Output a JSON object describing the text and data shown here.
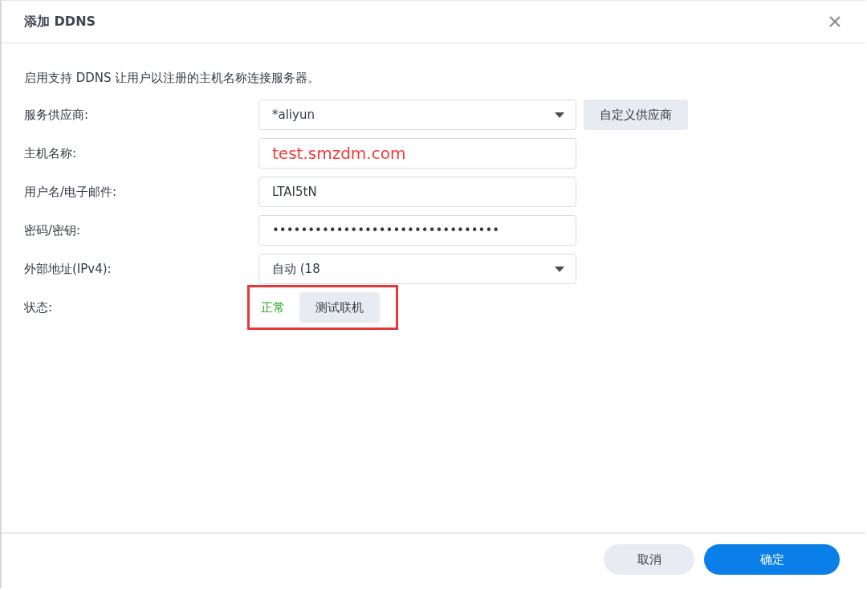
{
  "window": {
    "title": "添加 DDNS"
  },
  "description": "启用支持 DDNS 让用户以注册的主机名称连接服务器。",
  "fields": [
    {
      "label": "服务供应商:",
      "kind": "select",
      "value": "*aliyun",
      "highlight": false,
      "side_button": "自定义供应商"
    },
    {
      "label": "主机名称:",
      "kind": "text",
      "value": "test.smzdm.com",
      "highlight": true
    },
    {
      "label": "用户名/电子邮件:",
      "kind": "text",
      "value": "LTAI5tN",
      "highlight": false
    },
    {
      "label": "密码/密钥:",
      "kind": "text",
      "value": "••••••••••••••••••••••••••••••••",
      "highlight": false
    },
    {
      "label": "外部地址(IPv4):",
      "kind": "select",
      "value": "自动 (18",
      "highlight": false
    }
  ],
  "status": {
    "label": "状态:",
    "value": "正常",
    "button": "测试联机",
    "annotated": true
  },
  "buttons": [
    {
      "label": "取消",
      "primary": false
    },
    {
      "label": "确定",
      "primary": true
    }
  ]
}
